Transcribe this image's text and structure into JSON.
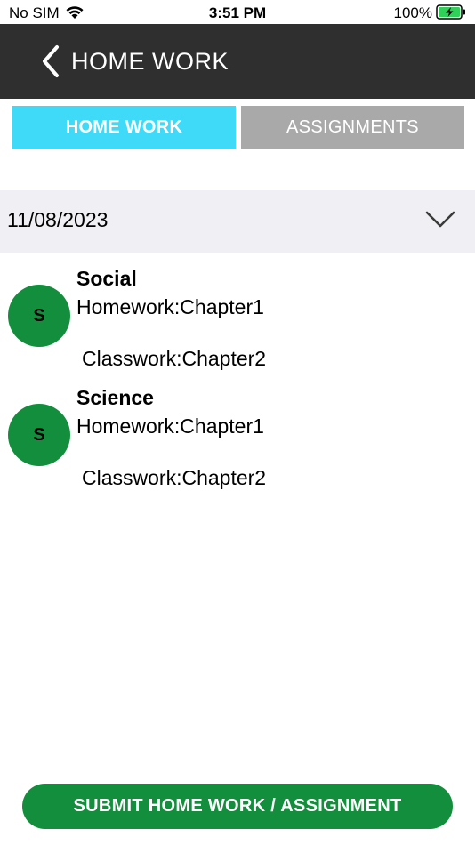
{
  "status_bar": {
    "carrier": "No SIM",
    "time": "3:51 PM",
    "battery": "100%"
  },
  "nav": {
    "title": "HOME WORK"
  },
  "tabs": [
    {
      "label": "HOME WORK",
      "active": true
    },
    {
      "label": "ASSIGNMENTS",
      "active": false
    }
  ],
  "date_selector": {
    "value": "11/08/2023"
  },
  "subjects": [
    {
      "initial": "S",
      "name": "Social",
      "homework": "Homework:Chapter1",
      "classwork": "Classwork:Chapter2"
    },
    {
      "initial": "S",
      "name": "Science",
      "homework": "Homework:Chapter1",
      "classwork": "Classwork:Chapter2"
    }
  ],
  "submit_button": {
    "label": "SUBMIT HOME WORK / ASSIGNMENT"
  },
  "colors": {
    "nav_bg": "#2f2f2f",
    "tab_active": "#3fdaf8",
    "tab_inactive": "#a9a9a9",
    "accent_green": "#138e3c",
    "date_row_bg": "#efeff4"
  }
}
